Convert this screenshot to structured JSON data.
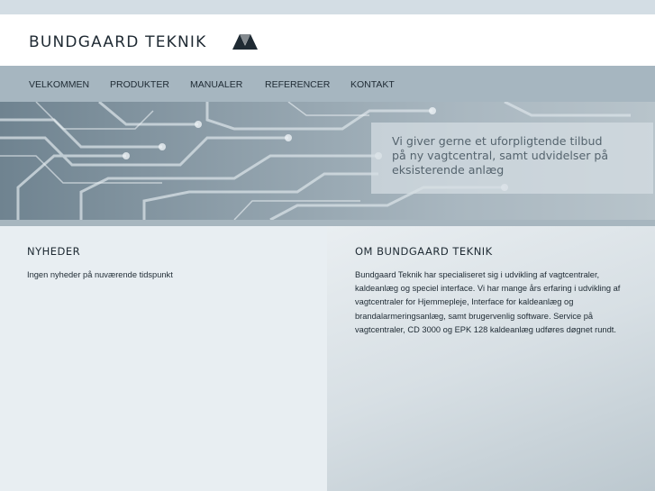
{
  "header": {
    "logo_text": "BUNDGAARD TEKNIK",
    "logo_icon": "twin-triangle-logo"
  },
  "nav": {
    "items": [
      {
        "label": "VELKOMMEN"
      },
      {
        "label": "PRODUKTER"
      },
      {
        "label": "MANUALER"
      },
      {
        "label": "REFERENCER"
      },
      {
        "label": "KONTAKT"
      }
    ]
  },
  "banner": {
    "image": "circuit-board-photo",
    "tagline": "Vi giver gerne et uforpligtende tilbud\npå ny vagtcentral, samt udvidelser på\neksisterende anlæg"
  },
  "news": {
    "heading": "NYHEDER",
    "text": "Ingen nyheder på nuværende tidspunkt"
  },
  "about": {
    "heading": "OM BUNDGAARD TEKNIK",
    "text": "Bundgaard Teknik har specialiseret sig i udvikling af vagtcentraler, kaldeanlæg og speciel interface. Vi har mange års erfaring i udvikling af vagtcentraler for Hjemmepleje, Interface for kaldeanlæg og brandalarmeringsanlæg, samt brugervenlig software. Service på vagtcentraler, CD 3000 og EPK 128 kaldeanlæg udføres døgnet rundt."
  },
  "colors": {
    "page_bg": "#d3dde4",
    "header_bg": "#ffffff",
    "nav_bg": "#a6b6c0",
    "text": "#1e2a33",
    "tagline_text": "#55646e"
  }
}
